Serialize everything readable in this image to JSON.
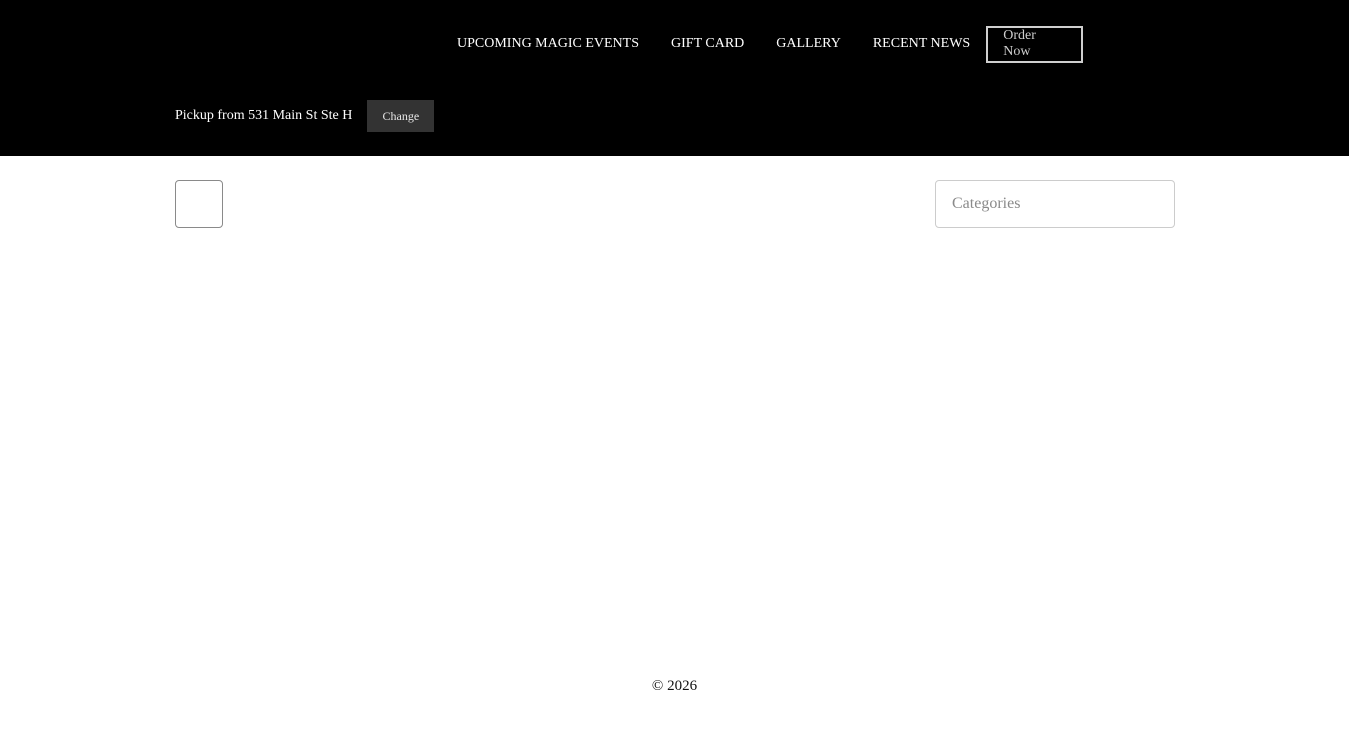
{
  "nav": {
    "items": [
      {
        "label": "UPCOMING MAGIC EVENTS"
      },
      {
        "label": "GIFT CARD"
      },
      {
        "label": "GALLERY"
      },
      {
        "label": "RECENT NEWS"
      }
    ],
    "order_label": "Order Now"
  },
  "pickup": {
    "text": "Pickup from 531 Main St Ste H",
    "change_label": "Change"
  },
  "filters": {
    "categories_label": "Categories"
  },
  "footer": {
    "copyright": "© 2026"
  },
  "colors": {
    "header_bg": "#000000",
    "nav_text": "#ffffff",
    "order_border": "#cfcfcf",
    "change_bg": "#333333"
  }
}
